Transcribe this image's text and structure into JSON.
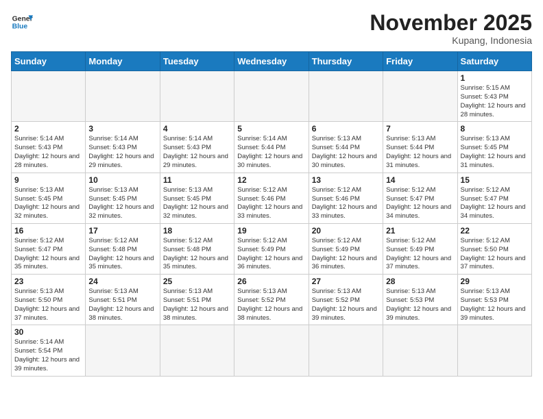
{
  "header": {
    "logo_general": "General",
    "logo_blue": "Blue",
    "month_title": "November 2025",
    "location": "Kupang, Indonesia"
  },
  "days_of_week": [
    "Sunday",
    "Monday",
    "Tuesday",
    "Wednesday",
    "Thursday",
    "Friday",
    "Saturday"
  ],
  "weeks": [
    [
      {
        "day": "",
        "sunrise": "",
        "sunset": "",
        "daylight": ""
      },
      {
        "day": "",
        "sunrise": "",
        "sunset": "",
        "daylight": ""
      },
      {
        "day": "",
        "sunrise": "",
        "sunset": "",
        "daylight": ""
      },
      {
        "day": "",
        "sunrise": "",
        "sunset": "",
        "daylight": ""
      },
      {
        "day": "",
        "sunrise": "",
        "sunset": "",
        "daylight": ""
      },
      {
        "day": "",
        "sunrise": "",
        "sunset": "",
        "daylight": ""
      },
      {
        "day": "1",
        "sunrise": "Sunrise: 5:15 AM",
        "sunset": "Sunset: 5:43 PM",
        "daylight": "Daylight: 12 hours and 28 minutes."
      }
    ],
    [
      {
        "day": "2",
        "sunrise": "Sunrise: 5:14 AM",
        "sunset": "Sunset: 5:43 PM",
        "daylight": "Daylight: 12 hours and 28 minutes."
      },
      {
        "day": "3",
        "sunrise": "Sunrise: 5:14 AM",
        "sunset": "Sunset: 5:43 PM",
        "daylight": "Daylight: 12 hours and 29 minutes."
      },
      {
        "day": "4",
        "sunrise": "Sunrise: 5:14 AM",
        "sunset": "Sunset: 5:43 PM",
        "daylight": "Daylight: 12 hours and 29 minutes."
      },
      {
        "day": "5",
        "sunrise": "Sunrise: 5:14 AM",
        "sunset": "Sunset: 5:44 PM",
        "daylight": "Daylight: 12 hours and 30 minutes."
      },
      {
        "day": "6",
        "sunrise": "Sunrise: 5:13 AM",
        "sunset": "Sunset: 5:44 PM",
        "daylight": "Daylight: 12 hours and 30 minutes."
      },
      {
        "day": "7",
        "sunrise": "Sunrise: 5:13 AM",
        "sunset": "Sunset: 5:44 PM",
        "daylight": "Daylight: 12 hours and 31 minutes."
      },
      {
        "day": "8",
        "sunrise": "Sunrise: 5:13 AM",
        "sunset": "Sunset: 5:45 PM",
        "daylight": "Daylight: 12 hours and 31 minutes."
      }
    ],
    [
      {
        "day": "9",
        "sunrise": "Sunrise: 5:13 AM",
        "sunset": "Sunset: 5:45 PM",
        "daylight": "Daylight: 12 hours and 32 minutes."
      },
      {
        "day": "10",
        "sunrise": "Sunrise: 5:13 AM",
        "sunset": "Sunset: 5:45 PM",
        "daylight": "Daylight: 12 hours and 32 minutes."
      },
      {
        "day": "11",
        "sunrise": "Sunrise: 5:13 AM",
        "sunset": "Sunset: 5:45 PM",
        "daylight": "Daylight: 12 hours and 32 minutes."
      },
      {
        "day": "12",
        "sunrise": "Sunrise: 5:12 AM",
        "sunset": "Sunset: 5:46 PM",
        "daylight": "Daylight: 12 hours and 33 minutes."
      },
      {
        "day": "13",
        "sunrise": "Sunrise: 5:12 AM",
        "sunset": "Sunset: 5:46 PM",
        "daylight": "Daylight: 12 hours and 33 minutes."
      },
      {
        "day": "14",
        "sunrise": "Sunrise: 5:12 AM",
        "sunset": "Sunset: 5:47 PM",
        "daylight": "Daylight: 12 hours and 34 minutes."
      },
      {
        "day": "15",
        "sunrise": "Sunrise: 5:12 AM",
        "sunset": "Sunset: 5:47 PM",
        "daylight": "Daylight: 12 hours and 34 minutes."
      }
    ],
    [
      {
        "day": "16",
        "sunrise": "Sunrise: 5:12 AM",
        "sunset": "Sunset: 5:47 PM",
        "daylight": "Daylight: 12 hours and 35 minutes."
      },
      {
        "day": "17",
        "sunrise": "Sunrise: 5:12 AM",
        "sunset": "Sunset: 5:48 PM",
        "daylight": "Daylight: 12 hours and 35 minutes."
      },
      {
        "day": "18",
        "sunrise": "Sunrise: 5:12 AM",
        "sunset": "Sunset: 5:48 PM",
        "daylight": "Daylight: 12 hours and 35 minutes."
      },
      {
        "day": "19",
        "sunrise": "Sunrise: 5:12 AM",
        "sunset": "Sunset: 5:49 PM",
        "daylight": "Daylight: 12 hours and 36 minutes."
      },
      {
        "day": "20",
        "sunrise": "Sunrise: 5:12 AM",
        "sunset": "Sunset: 5:49 PM",
        "daylight": "Daylight: 12 hours and 36 minutes."
      },
      {
        "day": "21",
        "sunrise": "Sunrise: 5:12 AM",
        "sunset": "Sunset: 5:49 PM",
        "daylight": "Daylight: 12 hours and 37 minutes."
      },
      {
        "day": "22",
        "sunrise": "Sunrise: 5:12 AM",
        "sunset": "Sunset: 5:50 PM",
        "daylight": "Daylight: 12 hours and 37 minutes."
      }
    ],
    [
      {
        "day": "23",
        "sunrise": "Sunrise: 5:13 AM",
        "sunset": "Sunset: 5:50 PM",
        "daylight": "Daylight: 12 hours and 37 minutes."
      },
      {
        "day": "24",
        "sunrise": "Sunrise: 5:13 AM",
        "sunset": "Sunset: 5:51 PM",
        "daylight": "Daylight: 12 hours and 38 minutes."
      },
      {
        "day": "25",
        "sunrise": "Sunrise: 5:13 AM",
        "sunset": "Sunset: 5:51 PM",
        "daylight": "Daylight: 12 hours and 38 minutes."
      },
      {
        "day": "26",
        "sunrise": "Sunrise: 5:13 AM",
        "sunset": "Sunset: 5:52 PM",
        "daylight": "Daylight: 12 hours and 38 minutes."
      },
      {
        "day": "27",
        "sunrise": "Sunrise: 5:13 AM",
        "sunset": "Sunset: 5:52 PM",
        "daylight": "Daylight: 12 hours and 39 minutes."
      },
      {
        "day": "28",
        "sunrise": "Sunrise: 5:13 AM",
        "sunset": "Sunset: 5:53 PM",
        "daylight": "Daylight: 12 hours and 39 minutes."
      },
      {
        "day": "29",
        "sunrise": "Sunrise: 5:13 AM",
        "sunset": "Sunset: 5:53 PM",
        "daylight": "Daylight: 12 hours and 39 minutes."
      }
    ],
    [
      {
        "day": "30",
        "sunrise": "Sunrise: 5:14 AM",
        "sunset": "Sunset: 5:54 PM",
        "daylight": "Daylight: 12 hours and 39 minutes."
      },
      {
        "day": "",
        "sunrise": "",
        "sunset": "",
        "daylight": ""
      },
      {
        "day": "",
        "sunrise": "",
        "sunset": "",
        "daylight": ""
      },
      {
        "day": "",
        "sunrise": "",
        "sunset": "",
        "daylight": ""
      },
      {
        "day": "",
        "sunrise": "",
        "sunset": "",
        "daylight": ""
      },
      {
        "day": "",
        "sunrise": "",
        "sunset": "",
        "daylight": ""
      },
      {
        "day": "",
        "sunrise": "",
        "sunset": "",
        "daylight": ""
      }
    ]
  ]
}
